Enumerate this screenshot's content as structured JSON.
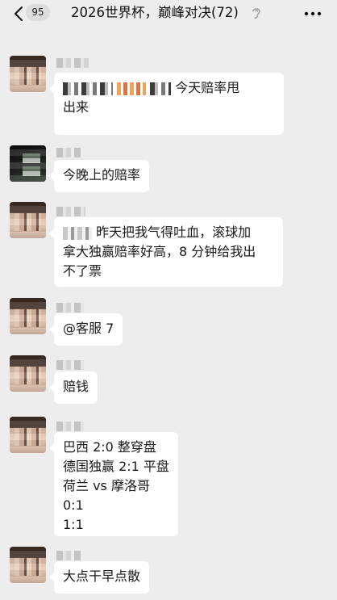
{
  "header": {
    "back_icon": "chevron-left-icon",
    "unread_count": "95",
    "title": "2026世界杯，巅峰对决(72)",
    "mute_icon": "ear-icon",
    "more_icon": "more-dots-icon"
  },
  "messages": [
    {
      "lines": [
        "今天赔率甩",
        "出来"
      ]
    },
    {
      "lines": [
        "今晚上的赔率"
      ]
    },
    {
      "lines": [
        "昨天把我气得吐血，滚球加",
        "拿大独赢赔率好高，8 分钟给我出",
        "不了票"
      ]
    },
    {
      "lines": [
        "@客服 7"
      ]
    },
    {
      "lines": [
        "赔钱"
      ]
    },
    {
      "lines": [
        "巴西 2:0 整穿盘",
        "德国独赢 2:1 平盘",
        "荷兰 vs 摩洛哥",
        "0:1",
        "1:1"
      ]
    },
    {
      "lines": [
        "大点干早点散"
      ]
    }
  ]
}
